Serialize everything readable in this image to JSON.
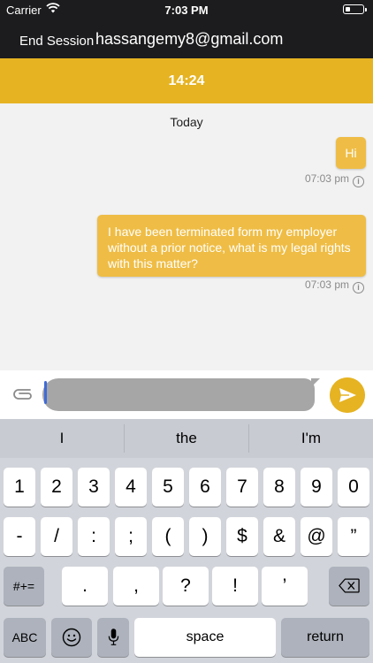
{
  "status_bar": {
    "carrier": "Carrier",
    "time": "7:03 PM"
  },
  "nav": {
    "end_session": "End Session",
    "email": "hassangemy8@gmail.com"
  },
  "timer": "14:24",
  "chat": {
    "date_label": "Today",
    "messages": [
      {
        "text": "Hi",
        "time": "07:03 pm"
      },
      {
        "text": "I have been terminated form my employer without a prior notice, what is my legal rights with this matter?",
        "time": "07:03 pm"
      }
    ]
  },
  "composer": {
    "value": ""
  },
  "keyboard": {
    "suggestions": [
      "I",
      "the",
      "I'm"
    ],
    "row1": [
      "1",
      "2",
      "3",
      "4",
      "5",
      "6",
      "7",
      "8",
      "9",
      "0"
    ],
    "row2": [
      "-",
      "/",
      ":",
      ";",
      "(",
      ")",
      "$",
      "&",
      "@",
      "”"
    ],
    "row3_mode": "#+=",
    "row3": [
      ".",
      ",",
      "?",
      "!",
      "’"
    ],
    "bottom": {
      "abc": "ABC",
      "space": "space",
      "return": "return"
    }
  },
  "colors": {
    "accent": "#e6b322",
    "bubble": "#efbd45",
    "header": "#1c1c1e"
  }
}
